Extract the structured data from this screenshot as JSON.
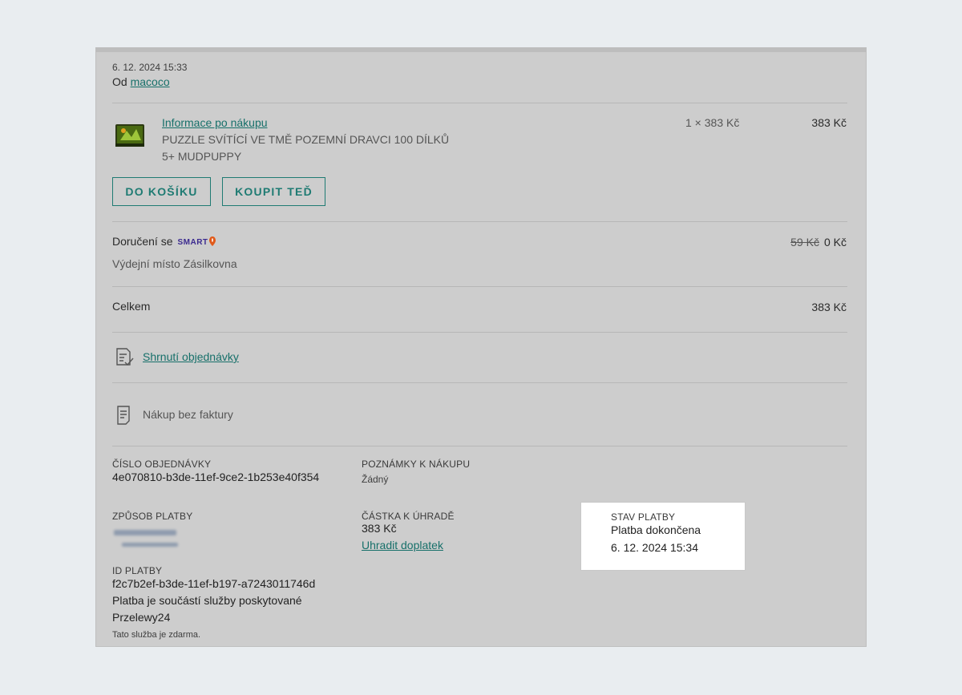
{
  "order": {
    "date": "6. 12. 2024 15:33",
    "from_prefix": "Od",
    "seller": "macoco"
  },
  "item": {
    "link": "Informace po nákupu",
    "name": "PUZZLE SVÍTÍCÍ VE TMĚ POZEMNÍ DRAVCI 100 DÍLKŮ",
    "variant": "5+ MUDPUPPY",
    "qty_price": "1 × 383 Kč",
    "total": "383 Kč",
    "btn_cart": "DO KOŠÍKU",
    "btn_buy": "KOUPIT TEĎ"
  },
  "delivery": {
    "label": "Doručení se",
    "badge": "SMART",
    "place": "Výdejní místo Zásilkovna",
    "old_price": "59 Kč",
    "price": "0 Kč"
  },
  "summary": {
    "label": "Celkem",
    "value": "383 Kč"
  },
  "links": {
    "order_summary": "Shrnutí objednávky",
    "no_invoice": "Nákup bez faktury"
  },
  "details": {
    "order_number_label": "ČÍSLO OBJEDNÁVKY",
    "order_number": "4e070810-b3de-11ef-9ce2-1b253e40f354",
    "notes_label": "POZNÁMKY K NÁKUPU",
    "notes": "Žádný",
    "payment_method_label": "ZPŮSOB PLATBY",
    "amount_label": "ČÁSTKA K ÚHRADĚ",
    "amount": "383 Kč",
    "pay_extra": "Uhradit doplatek",
    "status_label": "STAV PLATBY",
    "status": "Platba dokončena",
    "status_date": "6. 12. 2024 15:34",
    "payment_id_label": "ID PLATBY",
    "payment_id": "f2c7b2ef-b3de-11ef-b197-a7243011746d",
    "service_note_line1": "Platba je součástí služby poskytované",
    "service_note_line2": "Przelewy24",
    "free_note": "Tato služba je zdarma."
  },
  "colors": {
    "accent": "#1f7b73",
    "panel": "#cdcdcd",
    "background": "#e9edf0"
  }
}
